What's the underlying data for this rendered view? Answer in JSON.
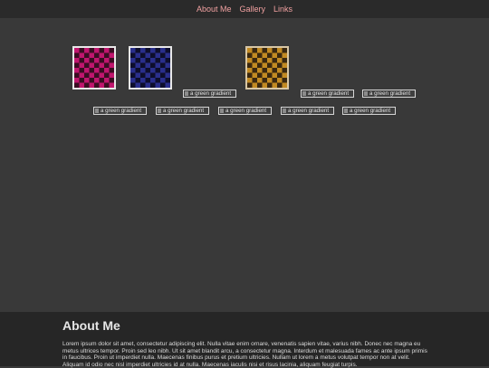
{
  "nav": {
    "items": [
      "About Me",
      "Gallery",
      "Links"
    ],
    "color": "#f0a0a0"
  },
  "gallery": {
    "thumbnails": [
      {
        "name": "pink-checker-thumbnail",
        "dark": "#3a0d22",
        "light": "#c0166e"
      },
      {
        "name": "blue-checker-thumbnail",
        "dark": "#0d0e2c",
        "light": "#2a2f8c"
      },
      {
        "name": "gold-checker-thumbnail",
        "dark": "#3a2810",
        "light": "#c28a22"
      }
    ],
    "broken_alt": "a green gradient"
  },
  "footer": {
    "heading": "About Me",
    "text": "Lorem ipsum dolor sit amet, consectetur adipiscing elit. Nulla vitae enim ornare, venenatis sapien vitae, varius nibh. Donec nec magna eu metus ultrices tempor. Proin sed leo nibh. Ut sit amet blandit arcu, a consectetur magna. Interdum et malesuada fames ac ante ipsum primis in faucibus. Proin ut imperdiet nulla. Maecenas finibus purus et pretium ultricies. Nullam ut lorem a metus volutpat tempor non at velit. Aliquam id odio nec nisl imperdiet ultricies id at nulla. Maecenas iaculis nisi et risus lacinia, aliquam feugiat turpis."
  }
}
